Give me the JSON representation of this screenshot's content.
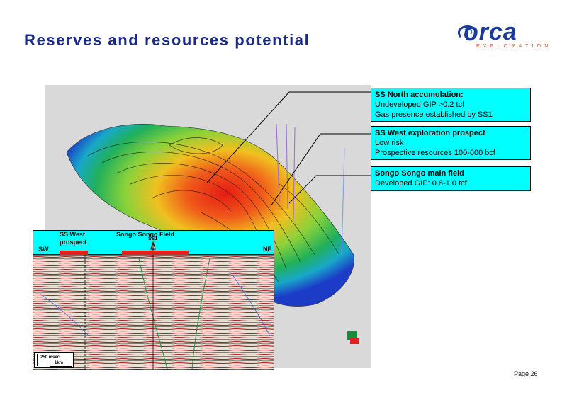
{
  "slide": {
    "title": "Reserves and resources  potential",
    "page_number": "Page 26"
  },
  "logo": {
    "word": "orca",
    "subtitle": "EXPLORATION",
    "brand_color": "#1a3a9c",
    "sub_color": "#d2572a"
  },
  "callouts": [
    {
      "heading": "SS North accumulation:",
      "lines": [
        "Undeveloped GIP >0.2 tcf",
        "Gas presence established by SS1"
      ]
    },
    {
      "heading": "SS West exploration prospect",
      "lines": [
        "Low risk",
        "Prospective resources 100-600 bcf"
      ]
    },
    {
      "heading": "Songo Songo main field",
      "lines": [
        "Developed GIP: 0.8-1.0 tcf"
      ]
    }
  ],
  "seismic": {
    "label_ss_west": "SS West",
    "label_prospect": "prospect",
    "label_field": "Songo Songo Field",
    "label_well": "SS1",
    "label_sw": "SW",
    "label_ne": "NE",
    "scale_time": "250 msec",
    "scale_dist": "1km"
  },
  "colors": {
    "callout_bg": "#00ffff",
    "title": "#1a2a8c",
    "highlight_bar": "#e8201a"
  }
}
